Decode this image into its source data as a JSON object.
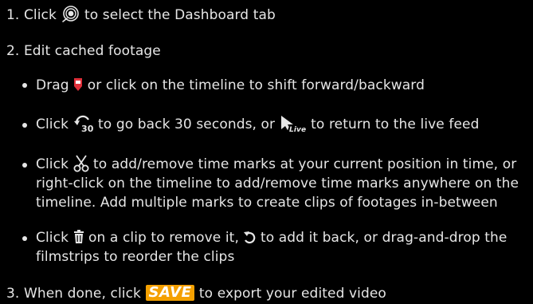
{
  "steps": [
    {
      "number": "1.",
      "pre": "Click",
      "icon": "dashboard-tab-icon",
      "post": "to select the Dashboard tab"
    },
    {
      "number": "2.",
      "text": "Edit cached footage",
      "bullets": [
        {
          "pre": "Drag",
          "icon": "timeline-marker-icon",
          "post": "or click on the timeline to shift forward/backward"
        },
        {
          "pre": "Click",
          "icon1": "rewind-30-icon",
          "mid": "to go back 30 seconds, or",
          "icon2": "live-feed-icon",
          "post": "to return to the live feed"
        },
        {
          "pre": "Click",
          "icon": "scissors-icon",
          "line1_post": "to add/remove time marks at your current position in time, or",
          "line2": "right-click on the timeline to add/remove time marks anywhere on the",
          "line3": "timeline. Add multiple marks to create clips of footages in-between"
        },
        {
          "pre": "Click",
          "icon1": "trash-icon",
          "mid": "on a clip to remove it,",
          "icon2": "undo-icon",
          "line1_post": "to add it back, or drag-and-drop the",
          "line2": "filmstrips to reorder the clips"
        }
      ]
    },
    {
      "number": "3.",
      "pre": "When done, click",
      "badge": "SAVE",
      "post": "to export your edited video"
    }
  ],
  "colors": {
    "background": "#000000",
    "text": "#e6e6e6",
    "marker": "#e0303a",
    "save": "#f4a000"
  }
}
